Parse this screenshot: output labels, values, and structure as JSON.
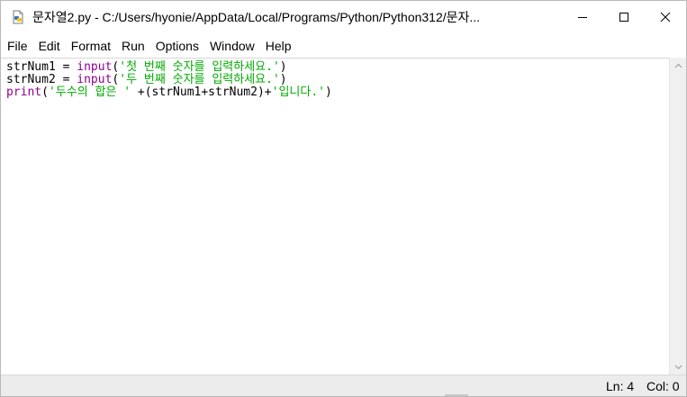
{
  "window": {
    "title": "문자열2.py - C:/Users/hyonie/AppData/Local/Programs/Python/Python312/문자...",
    "icon": "python-file-icon",
    "controls": [
      "minimize-icon",
      "maximize-icon",
      "close-icon"
    ]
  },
  "menu": {
    "items": [
      "File",
      "Edit",
      "Format",
      "Run",
      "Options",
      "Window",
      "Help"
    ]
  },
  "editor": {
    "lines": [
      [
        {
          "t": "strNum1 = ",
          "k": "plain"
        },
        {
          "t": "input",
          "k": "builtin"
        },
        {
          "t": "(",
          "k": "plain"
        },
        {
          "t": "'첫 번째 숫자를 입력하세요.'",
          "k": "string"
        },
        {
          "t": ")",
          "k": "plain"
        }
      ],
      [
        {
          "t": "strNum2 = ",
          "k": "plain"
        },
        {
          "t": "input",
          "k": "builtin"
        },
        {
          "t": "(",
          "k": "plain"
        },
        {
          "t": "'두 번째 숫자를 입력하세요.'",
          "k": "string"
        },
        {
          "t": ")",
          "k": "plain"
        }
      ],
      [
        {
          "t": "print",
          "k": "builtin"
        },
        {
          "t": "(",
          "k": "plain"
        },
        {
          "t": "'두수의 합은 '",
          "k": "string"
        },
        {
          "t": " +(strNum1+strNum2)+",
          "k": "plain"
        },
        {
          "t": "'입니다.'",
          "k": "string"
        },
        {
          "t": ")",
          "k": "plain"
        }
      ]
    ]
  },
  "status": {
    "ln": "Ln: 4",
    "col": "Col: 0"
  },
  "colors": {
    "builtin": "#900090",
    "string": "#00aa00",
    "plain": "#000000"
  }
}
